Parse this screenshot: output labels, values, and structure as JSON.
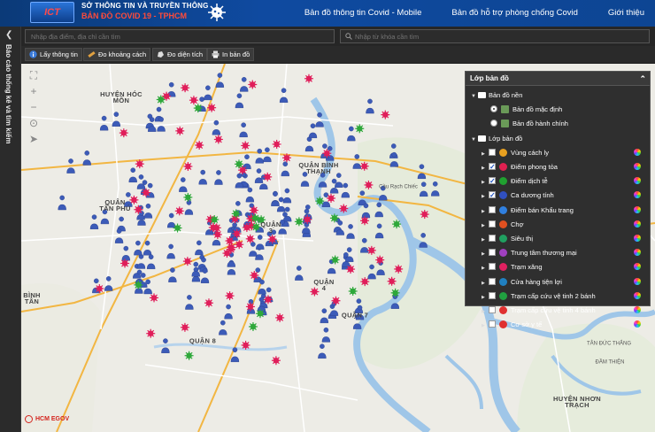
{
  "header": {
    "logo_text": "ICT",
    "org_name": "SỞ THÔNG TIN VÀ TRUYỀN THÔNG",
    "app_name": "BẢN ĐỒ COVID 19 - TPHCM",
    "nav": [
      "Bản đồ thông tin Covid - Mobile",
      "Bản đồ hỗ trợ phòng chống Covid",
      "Giới thiệu"
    ]
  },
  "sidebar": {
    "title": "Báo cáo thống kê và tìm kiếm"
  },
  "search": {
    "address_placeholder": "Nhập địa điểm, địa chỉ cần tìm",
    "keyword_placeholder": "Nhập từ khóa cần tìm"
  },
  "toolbar": {
    "info_label": "Lấy thông tin",
    "distance_label": "Đo khoảng cách",
    "area_label": "Đo diện tích",
    "print_label": "In bản đồ"
  },
  "layer_panel": {
    "title": "Lớp bản đồ",
    "base_group": "Bản đồ nền",
    "base_layers": [
      {
        "label": "Bản đồ mặc định",
        "selected": true
      },
      {
        "label": "Bản đồ hành chính",
        "selected": false
      }
    ],
    "overlay_group": "Lớp bản đồ",
    "overlay_layers": [
      {
        "label": "Vùng cách ly",
        "checked": false,
        "color": "#e8a020"
      },
      {
        "label": "Điểm phong tỏa",
        "checked": true,
        "color": "#e02050"
      },
      {
        "label": "Điểm dịch tễ",
        "checked": true,
        "color": "#20a030"
      },
      {
        "label": "Ca dương tính",
        "checked": true,
        "color": "#3050c0"
      },
      {
        "label": "Điểm bán Khẩu trang",
        "checked": false,
        "color": "#3080e0"
      },
      {
        "label": "Chợ",
        "checked": false,
        "color": "#e05020"
      },
      {
        "label": "Siêu thị",
        "checked": false,
        "color": "#20a060"
      },
      {
        "label": "Trung tâm thương mại",
        "checked": false,
        "color": "#a040c0"
      },
      {
        "label": "Trạm xăng",
        "checked": false,
        "color": "#e02060"
      },
      {
        "label": "Cửa hàng tiện lợi",
        "checked": false,
        "color": "#2080c0"
      },
      {
        "label": "Trạm cấp cứu vệ tinh 2 bánh",
        "checked": false,
        "color": "#20a040"
      },
      {
        "label": "Trạm cấp cứu vệ tinh 4 bánh",
        "checked": false,
        "color": "#e03030"
      },
      {
        "label": "Cơ sở y tế",
        "checked": false,
        "color": "#e03030"
      }
    ]
  },
  "map": {
    "labels": [
      {
        "text": "HUYỆN HÓC\nMÔN"
      },
      {
        "text": "QUẬN BÌNH\nTHẠNH"
      },
      {
        "text": "QUẬN\nTÂN PHÚ"
      },
      {
        "text": "QUẬN\n3"
      },
      {
        "text": "QUẬN\n4"
      },
      {
        "text": "QUẬN 7"
      },
      {
        "text": "QUẬN 8"
      },
      {
        "text": "BÌNH\nTÂN"
      },
      {
        "text": "HUYỆN NHƠN\nTRẠCH"
      },
      {
        "text": "Cầu Rạch Chiếc"
      },
      {
        "text": "TÂN ĐỨC THẮNG"
      },
      {
        "text": "ĐẦM THIỆN"
      }
    ]
  },
  "footer": {
    "brand": "HCM EGOV"
  },
  "colors": {
    "header_bg": "#0f4aa0",
    "positive_case": "#3c5bb8",
    "lockdown": "#e01e5a",
    "epidemic_point": "#2ea83a",
    "river": "#9fc6e8"
  }
}
